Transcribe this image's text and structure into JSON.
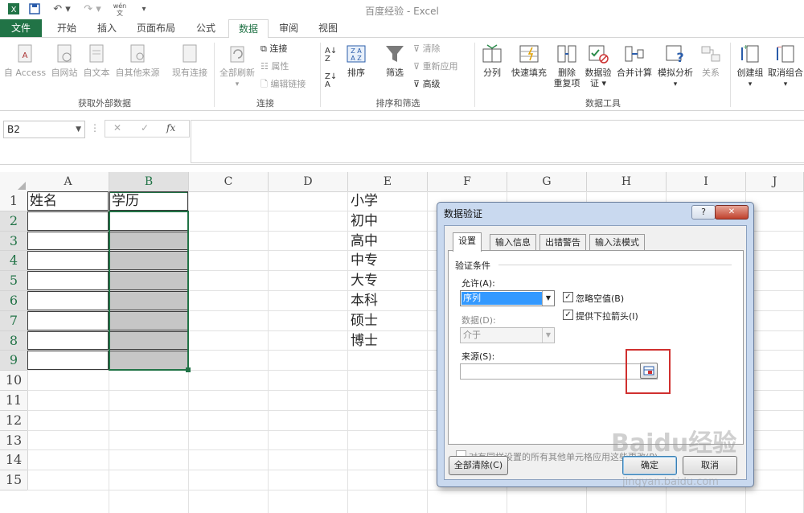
{
  "window": {
    "title": "百度经验 - Excel"
  },
  "quick_access": {
    "wen_label": "wén\n文"
  },
  "tabs": [
    {
      "label": "文件",
      "kind": "file"
    },
    {
      "label": "开始"
    },
    {
      "label": "插入"
    },
    {
      "label": "页面布局"
    },
    {
      "label": "公式"
    },
    {
      "label": "数据",
      "kind": "active"
    },
    {
      "label": "审阅"
    },
    {
      "label": "视图"
    }
  ],
  "ribbon": {
    "external": {
      "access": "自 Access",
      "web": "自网站",
      "text": "自文本",
      "other": "自其他来源",
      "existing": "现有连接",
      "group": "获取外部数据"
    },
    "connections": {
      "refresh_all": "全部刷新",
      "connections": "连接",
      "properties": "属性",
      "edit_links": "编辑链接",
      "group": "连接"
    },
    "sort": {
      "az": "A↓Z",
      "sort": "排序",
      "filter": "筛选",
      "clear": "清除",
      "reapply": "重新应用",
      "advanced": "高级",
      "group": "排序和筛选"
    },
    "tools": {
      "split": "分列",
      "flash_fill": "快速填充",
      "remove_dup_1": "删除",
      "remove_dup_2": "重复项",
      "validation_1": "数据验",
      "validation_2": "证 ▾",
      "consolidate": "合并计算",
      "whatif": "模拟分析",
      "relationships": "关系",
      "group": "数据工具"
    },
    "outline": {
      "group_btn": "创建组",
      "ungroup": "取消组合"
    }
  },
  "formula_bar": {
    "name_box": "B2",
    "fx": "fx",
    "cancel": "✕",
    "enter": "✓"
  },
  "sheet": {
    "columns": [
      "A",
      "B",
      "C",
      "D",
      "E",
      "F",
      "G",
      "H",
      "I",
      "J"
    ],
    "rows": [
      "1",
      "2",
      "3",
      "4",
      "5",
      "6",
      "7",
      "8",
      "9",
      "10",
      "11",
      "12",
      "13",
      "14",
      "15"
    ],
    "cells": {
      "A1": "姓名",
      "B1": "学历",
      "E1": "小学",
      "E2": "初中",
      "E3": "高中",
      "E4": "中专",
      "E5": "大专",
      "E6": "本科",
      "E7": "硕士",
      "E8": "博士"
    },
    "selected_col": "B"
  },
  "dialog": {
    "title": "数据验证",
    "help": "?",
    "close": "✕",
    "tabs": [
      "设置",
      "输入信息",
      "出错警告",
      "输入法模式"
    ],
    "section": "验证条件",
    "allow_label": "允许(A):",
    "allow_value": "序列",
    "data_label": "数据(D):",
    "data_value": "介于",
    "ignore_blank": "忽略空值(B)",
    "dropdown": "提供下拉箭头(I)",
    "source_label": "来源(S):",
    "source_value": "",
    "apply_all": "对有同样设置的所有其他单元格应用这些更改(P)",
    "clear_all": "全部清除(C)",
    "ok": "确定",
    "cancel": "取消"
  },
  "watermark": {
    "text": "Baidu经验",
    "url": "jingyan.baidu.com"
  },
  "colors": {
    "excel_green": "#217346",
    "highlight": "#d0302f",
    "selected_fill": "#c6c6c6"
  }
}
